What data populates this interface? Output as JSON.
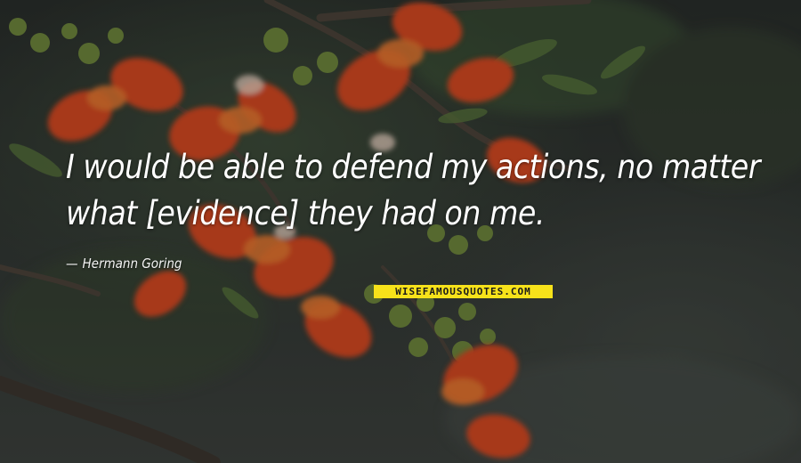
{
  "quote": {
    "text": "I would be able to defend my actions, no matter what [evidence] they had on me."
  },
  "author": {
    "name": "Hermann Goring"
  },
  "watermark": {
    "text": "WISEFAMOUSQUOTES.COM",
    "background": "#f7e21a"
  },
  "background": {
    "description_icon": "flower-branch-photo"
  },
  "colors": {
    "petal": "#e0471c",
    "petal_light": "#f27a2e",
    "leaf": "#5a7a3a",
    "branch": "#4a4036"
  }
}
